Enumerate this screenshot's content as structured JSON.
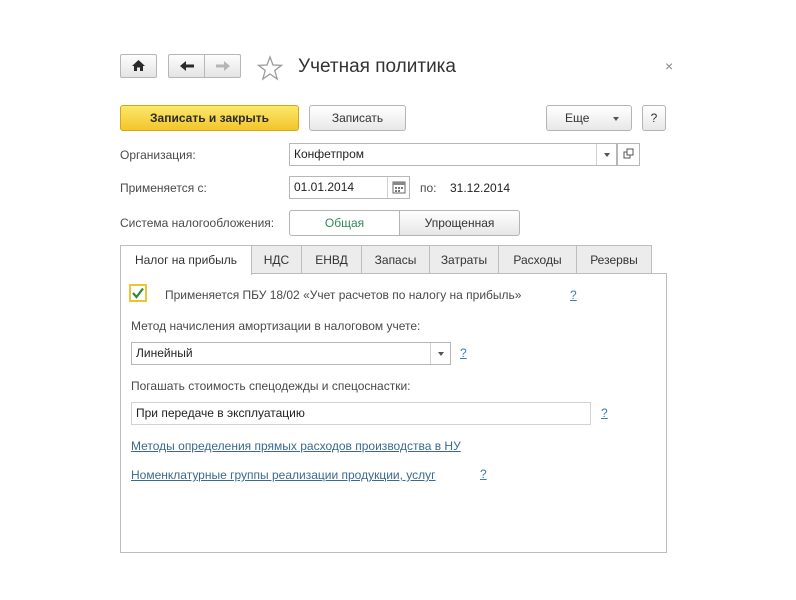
{
  "window": {
    "title": "Учетная политика",
    "close_glyph": "×"
  },
  "toolbar": {
    "save_close_label": "Записать и закрыть",
    "save_label": "Записать",
    "more_label": "Еще",
    "help_label": "?"
  },
  "form": {
    "organization_label": "Организация:",
    "organization_value": "Конфетпром",
    "applies_from_label": "Применяется с:",
    "applies_from_value": "01.01.2014",
    "applies_to_label": "по:",
    "applies_to_value": "31.12.2014",
    "tax_system_label": "Система налогообложения:",
    "tax_system_options": [
      "Общая",
      "Упрощенная"
    ],
    "tax_system_selected": "Общая"
  },
  "tabs": [
    "Налог на прибыль",
    "НДС",
    "ЕНВД",
    "Запасы",
    "Затраты",
    "Расходы",
    "Резервы"
  ],
  "active_tab": "Налог на прибыль",
  "profit_tax": {
    "pbu_checkbox_checked": true,
    "pbu_checkbox_label": "Применяется ПБУ 18/02 «Учет расчетов по налогу на прибыль»",
    "pbu_help": "?",
    "depreciation_label": "Метод начисления амортизации в налоговом учете:",
    "depreciation_value": "Линейный",
    "depreciation_help": "?",
    "workwear_label": "Погашать стоимость спецодежды и спецоснастки:",
    "workwear_value": "При передаче в эксплуатацию",
    "workwear_help": "?",
    "direct_costs_link": "Методы определения прямых расходов производства в НУ",
    "nomenclature_link": "Номенклатурные группы реализации продукции, услуг",
    "nomenclature_help": "?"
  },
  "colors": {
    "primary_button": "#f3c52b",
    "link": "#3a6a8d",
    "selected_segment_text": "#2e8b57",
    "checkbox_check": "#2e8b2e"
  }
}
